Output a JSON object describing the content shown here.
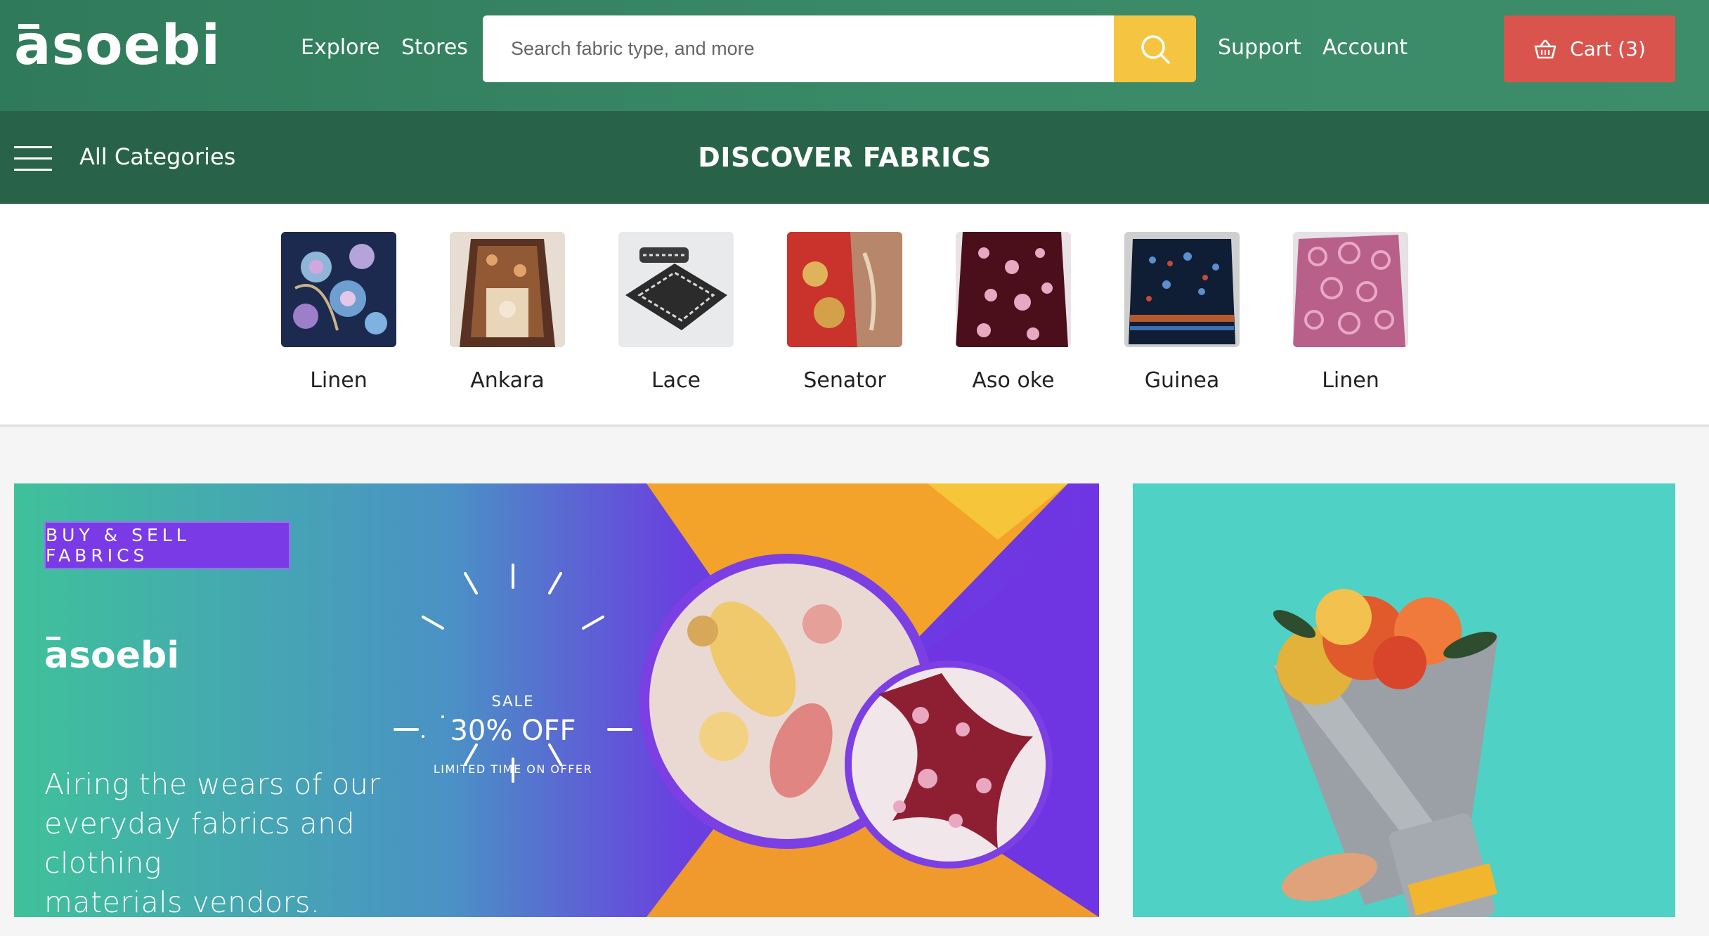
{
  "header": {
    "logo": "asoebi",
    "nav": {
      "explore": "Explore",
      "stores": "Stores",
      "support": "Support",
      "account": "Account"
    },
    "search": {
      "placeholder": "Search fabric type, and more"
    },
    "cart_label": "Cart (3)"
  },
  "category_bar": {
    "all_categories": "All Categories",
    "title": "DISCOVER FABRICS"
  },
  "fabrics": [
    {
      "label": "Linen"
    },
    {
      "label": "Ankara"
    },
    {
      "label": "Lace"
    },
    {
      "label": "Senator"
    },
    {
      "label": "Aso oke"
    },
    {
      "label": "Guinea"
    },
    {
      "label": "Linen"
    }
  ],
  "promo_banner": {
    "tag": "BUY & SELL FABRICS",
    "logo": "asoebi",
    "sale": "SALE",
    "discount": "30% OFF",
    "offer_note": "LIMITED TIME ON OFFER",
    "copy_lines": [
      "Airing the wears of our",
      "everyday fabrics and clothing",
      "materials vendors."
    ]
  },
  "colors": {
    "header_green": "#3a8a68",
    "category_green": "#286349",
    "search_yellow": "#f5c542",
    "cart_red": "#d9544d",
    "tag_purple": "#7a3be6",
    "side_banner_teal": "#4fd1c5"
  },
  "icons": {
    "search": "search-icon",
    "cart": "basket-icon",
    "menu": "hamburger-icon"
  }
}
